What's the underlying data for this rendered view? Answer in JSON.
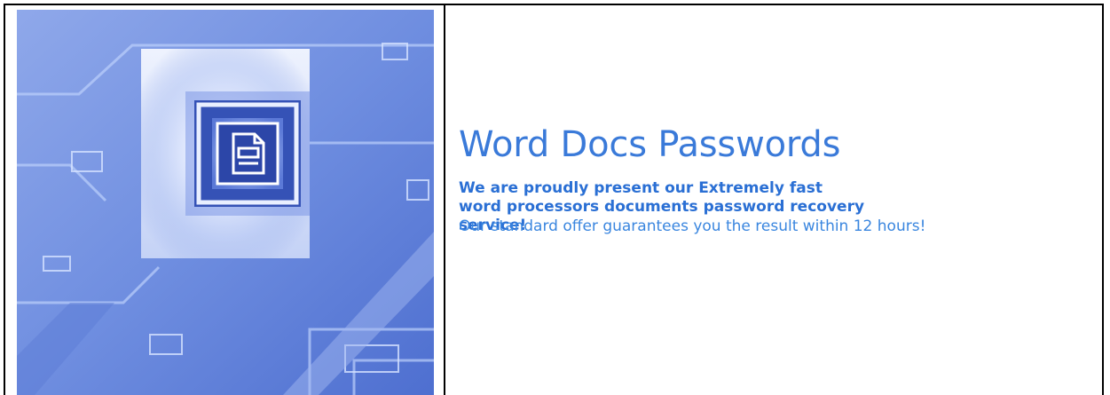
{
  "hero": {
    "image_subject": "document icon on circuit background",
    "icon": "document-icon",
    "colors": {
      "background": "#6f8ee0",
      "highlight": "#ffffff",
      "deep": "#3552b6"
    }
  },
  "content": {
    "title": "Word Docs Passwords",
    "intro": "We are proudly present our Extremely fast word processors documents password recovery service!",
    "offer": "Our standard offer guarantees you the result within 12 hours!"
  },
  "colors": {
    "title": "#3a7ad9",
    "intro": "#2a6fd4",
    "offer": "#3a86df",
    "border": "#000000"
  }
}
